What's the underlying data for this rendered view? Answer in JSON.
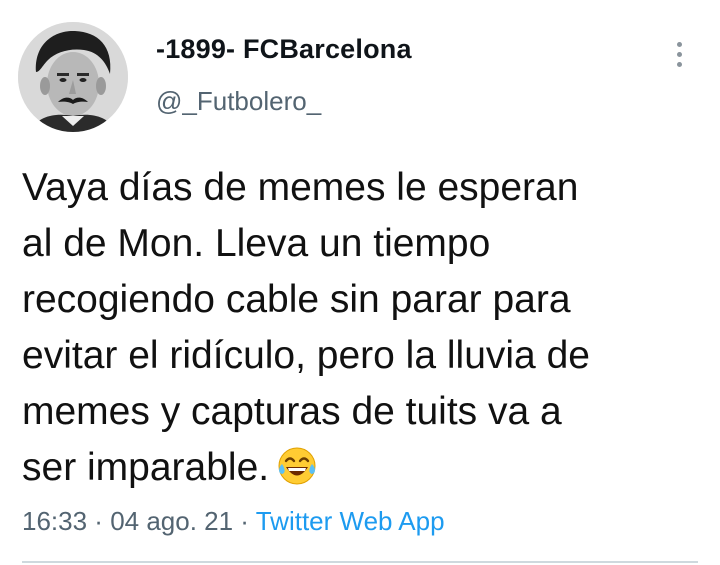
{
  "user": {
    "display_name": "-1899- FCBarcelona",
    "handle": "@_Futbolero_",
    "avatar_icon": "vintage-portrait-avatar"
  },
  "menu": {
    "icon": "more-vertical-icon"
  },
  "tweet": {
    "lines": [
      "Vaya días de memes le esperan",
      "al de Mon. Lleva un tiempo",
      "recogiendo cable sin parar para",
      "evitar el ridículo, pero la lluvia de",
      "memes y capturas de tuits va a",
      "ser imparable."
    ],
    "emoji": "face-with-tears-of-joy"
  },
  "meta": {
    "time": "16:33",
    "separator": " · ",
    "date": "04 ago. 21",
    "source": "Twitter Web App"
  },
  "colors": {
    "text": "#0f1419",
    "secondary": "#536471",
    "link": "#1d9bf0",
    "divider": "#cfd9de"
  }
}
